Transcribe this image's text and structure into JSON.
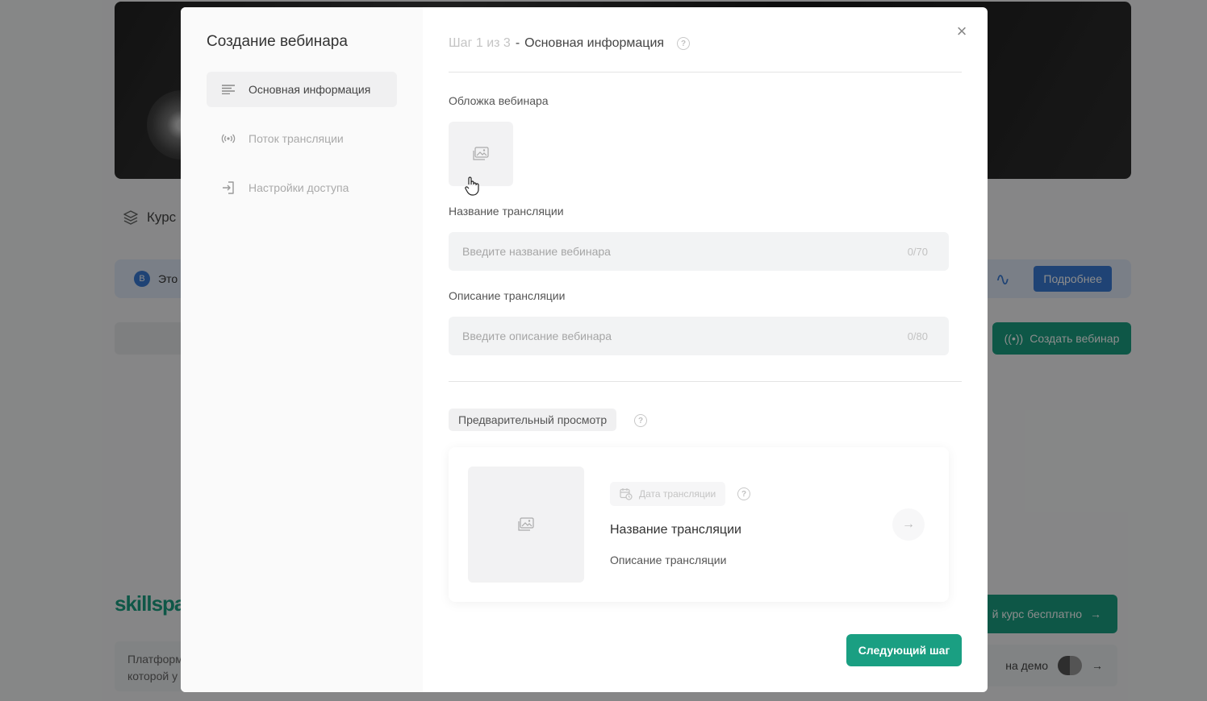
{
  "background": {
    "courses_label": "Курс",
    "banner_text": "Это",
    "banner_badge": "B",
    "more_button": "Подробнее",
    "create_webinar_button": "Создать вебинар",
    "logo": "skillspa",
    "free_course_button": "й курс бесплатно",
    "platform_text_1": "Платформ",
    "platform_text_2": "которой у",
    "demo_text": "на демо"
  },
  "modal": {
    "sidebar_title": "Создание вебинара",
    "nav": [
      {
        "label": "Основная информация",
        "icon": "lines-icon",
        "active": true
      },
      {
        "label": "Поток трансляции",
        "icon": "broadcast-icon",
        "active": false
      },
      {
        "label": "Настройки доступа",
        "icon": "login-icon",
        "active": false
      }
    ],
    "step_number": "Шаг 1 из 3",
    "step_separator": "-",
    "step_title": "Основная информация",
    "cover_label": "Обложка вебинара",
    "name_label": "Название трансляции",
    "name_placeholder": "Введите название вебинара",
    "name_counter": "0/70",
    "desc_label": "Описание трансляции",
    "desc_placeholder": "Введите описание вебинара",
    "desc_counter": "0/80",
    "preview_label": "Предварительный просмотр",
    "card": {
      "date_label": "Дата трансляции",
      "title": "Название трансляции",
      "description": "Описание трансляции"
    },
    "next_button": "Следующий шаг",
    "close_symbol": "×",
    "help_symbol": "?",
    "arrow_symbol": "→"
  }
}
